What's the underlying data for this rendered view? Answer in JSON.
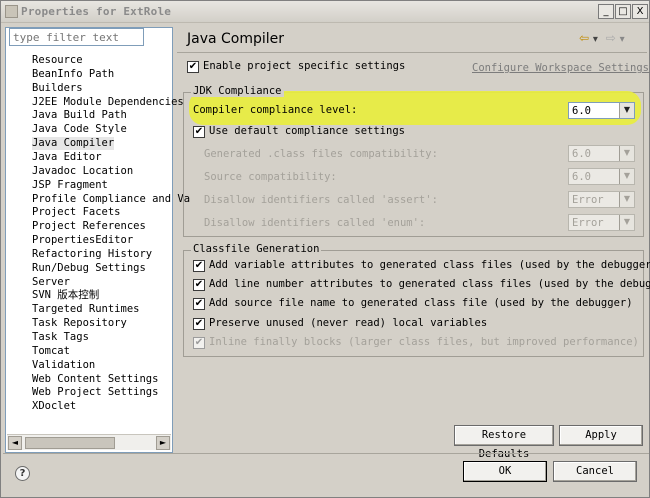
{
  "window": {
    "title": "Properties for ExtRole",
    "min_label": "_",
    "max_label": "□",
    "close_label": "X"
  },
  "left": {
    "filter_placeholder": "type filter text",
    "items": [
      {
        "label": "Resource"
      },
      {
        "label": "BeanInfo Path"
      },
      {
        "label": "Builders"
      },
      {
        "label": "J2EE Module Dependencies"
      },
      {
        "label": "Java Build Path"
      },
      {
        "label": "Java Code Style"
      },
      {
        "label": "Java Compiler",
        "selected": true
      },
      {
        "label": "Java Editor"
      },
      {
        "label": "Javadoc Location"
      },
      {
        "label": "JSP Fragment"
      },
      {
        "label": "Profile Compliance and Va"
      },
      {
        "label": "Project Facets"
      },
      {
        "label": "Project References"
      },
      {
        "label": "PropertiesEditor"
      },
      {
        "label": "Refactoring History"
      },
      {
        "label": "Run/Debug Settings"
      },
      {
        "label": "Server"
      },
      {
        "label": "SVN 版本控制"
      },
      {
        "label": "Targeted Runtimes"
      },
      {
        "label": "Task Repository"
      },
      {
        "label": "Task Tags"
      },
      {
        "label": "Tomcat"
      },
      {
        "label": "Validation"
      },
      {
        "label": "Web Content Settings"
      },
      {
        "label": "Web Project Settings"
      },
      {
        "label": "XDoclet"
      }
    ],
    "scroll_left": "◄",
    "scroll_right": "►"
  },
  "right": {
    "title": "Java Compiler",
    "enable_specific": "Enable project specific settings",
    "configure_link": "Configure Workspace Settings...",
    "jdk_group": "JDK Compliance",
    "compliance_label": "Compiler compliance level:",
    "compliance_value": "6.0",
    "use_default": "Use default compliance settings",
    "generated_label": "Generated .class files compatibility:",
    "generated_value": "6.0",
    "source_label": "Source compatibility:",
    "source_value": "6.0",
    "assert_label": "Disallow identifiers called 'assert':",
    "assert_value": "Error",
    "enum_label": "Disallow identifiers called 'enum':",
    "enum_value": "Error",
    "classfile_group": "Classfile Generation",
    "cf_variable": "Add variable attributes to generated class files (used by the debugger)",
    "cf_line": "Add line number attributes to generated class files (used by the debugger)",
    "cf_source": "Add source file name to generated class file (used by the debugger)",
    "cf_preserve": "Preserve unused (never read) local variables",
    "cf_inline": "Inline finally blocks (larger class files, but improved performance)"
  },
  "buttons": {
    "restore": "Restore Defaults",
    "apply": "Apply",
    "ok": "OK",
    "cancel": "Cancel",
    "help": "?"
  },
  "icons": {
    "check": "✔",
    "dropdown": "▼",
    "back": "⇦",
    "forward": "⇨",
    "nav_menu": "▾"
  },
  "colors": {
    "highlight": "#e8ed3e"
  }
}
